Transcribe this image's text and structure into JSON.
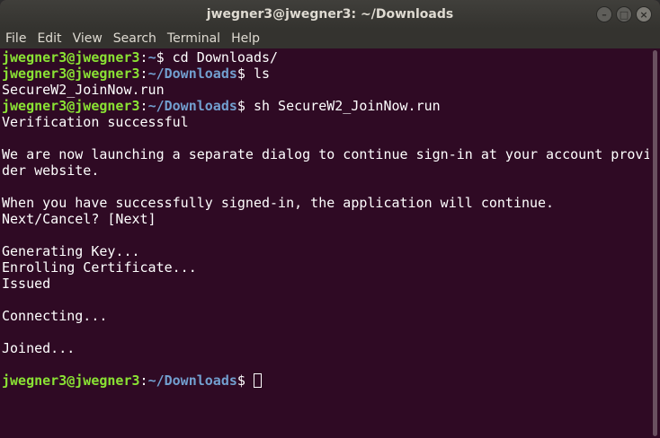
{
  "window": {
    "title": "jwegner3@jwegner3: ~/Downloads",
    "buttons": {
      "minimize": "–",
      "maximize": "□",
      "close": "×"
    }
  },
  "menu": {
    "items": [
      "File",
      "Edit",
      "View",
      "Search",
      "Terminal",
      "Help"
    ]
  },
  "terminal": {
    "prompt_user": "jwegner3@jwegner3",
    "sep": ":",
    "home_path": "~",
    "dl_path": "~/Downloads",
    "dollar": "$ ",
    "lines": [
      {
        "type": "prompt",
        "path": "~",
        "cmd": "cd Downloads/"
      },
      {
        "type": "prompt",
        "path": "~/Downloads",
        "cmd": "ls"
      },
      {
        "type": "out",
        "text": "SecureW2_JoinNow.run"
      },
      {
        "type": "prompt",
        "path": "~/Downloads",
        "cmd": "sh SecureW2_JoinNow.run"
      },
      {
        "type": "out",
        "text": "Verification successful"
      },
      {
        "type": "out",
        "text": ""
      },
      {
        "type": "out",
        "text": "We are now launching a separate dialog to continue sign-in at your account provi"
      },
      {
        "type": "out",
        "text": "der website."
      },
      {
        "type": "out",
        "text": ""
      },
      {
        "type": "out",
        "text": "When you have successfully signed-in, the application will continue."
      },
      {
        "type": "out",
        "text": "Next/Cancel? [Next]"
      },
      {
        "type": "out",
        "text": ""
      },
      {
        "type": "out",
        "text": "Generating Key..."
      },
      {
        "type": "out",
        "text": "Enrolling Certificate..."
      },
      {
        "type": "out",
        "text": "Issued"
      },
      {
        "type": "out",
        "text": ""
      },
      {
        "type": "out",
        "text": "Connecting..."
      },
      {
        "type": "out",
        "text": ""
      },
      {
        "type": "out",
        "text": "Joined..."
      },
      {
        "type": "out",
        "text": ""
      },
      {
        "type": "prompt",
        "path": "~/Downloads",
        "cmd": "",
        "cursor": true
      }
    ]
  }
}
